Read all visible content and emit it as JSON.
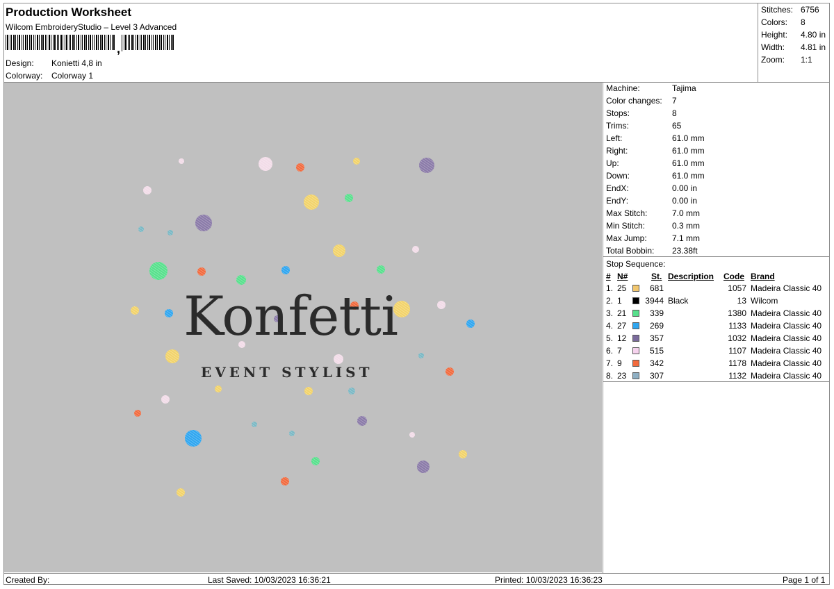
{
  "header": {
    "title": "Production Worksheet",
    "subtitle": "Wilcom EmbroideryStudio – Level 3 Advanced",
    "design_label": "Design:",
    "design_value": "Konietti 4,8 in",
    "colorway_label": "Colorway:",
    "colorway_value": "Colorway 1"
  },
  "summary": [
    {
      "label": "Stitches:",
      "value": "6756"
    },
    {
      "label": "Colors:",
      "value": "8"
    },
    {
      "label": "Height:",
      "value": "4.80 in"
    },
    {
      "label": "Width:",
      "value": "4.81 in"
    },
    {
      "label": "Zoom:",
      "value": "1:1"
    }
  ],
  "machine_info": [
    {
      "label": "Machine:",
      "value": "Tajima"
    },
    {
      "label": "Color changes:",
      "value": "7"
    },
    {
      "label": "Stops:",
      "value": "8"
    },
    {
      "label": "Trims:",
      "value": "65"
    },
    {
      "label": "Left:",
      "value": "61.0 mm"
    },
    {
      "label": "Right:",
      "value": "61.0 mm"
    },
    {
      "label": "Up:",
      "value": "61.0 mm"
    },
    {
      "label": "Down:",
      "value": "61.0 mm"
    },
    {
      "label": "EndX:",
      "value": "0.00 in"
    },
    {
      "label": "EndY:",
      "value": "0.00 in"
    },
    {
      "label": "Max Stitch:",
      "value": "7.0 mm"
    },
    {
      "label": "Min Stitch:",
      "value": "0.3 mm"
    },
    {
      "label": "Max Jump:",
      "value": "7.1 mm"
    },
    {
      "label": "Total Bobbin:",
      "value": "23.38ft"
    }
  ],
  "stop_sequence": {
    "title": "Stop Sequence:",
    "columns": {
      "hash": "#",
      "n": "N#",
      "st": "St.",
      "description": "Description",
      "code": "Code",
      "brand": "Brand"
    },
    "rows": [
      {
        "idx": "1.",
        "n": "25",
        "color": "#f2c76e",
        "st": "681",
        "description": "",
        "code": "1057",
        "brand": "Madeira Classic 40"
      },
      {
        "idx": "2.",
        "n": "1",
        "color": "#000000",
        "st": "3944",
        "description": "Black",
        "code": "13",
        "brand": "Wilcom"
      },
      {
        "idx": "3.",
        "n": "21",
        "color": "#57e08c",
        "st": "339",
        "description": "",
        "code": "1380",
        "brand": "Madeira Classic 40"
      },
      {
        "idx": "4.",
        "n": "27",
        "color": "#2fa6f0",
        "st": "269",
        "description": "",
        "code": "1133",
        "brand": "Madeira Classic 40"
      },
      {
        "idx": "5.",
        "n": "12",
        "color": "#7a6a9c",
        "st": "357",
        "description": "",
        "code": "1032",
        "brand": "Madeira Classic 40"
      },
      {
        "idx": "6.",
        "n": "7",
        "color": "#f6d3ee",
        "st": "515",
        "description": "",
        "code": "1107",
        "brand": "Madeira Classic 40"
      },
      {
        "idx": "7.",
        "n": "9",
        "color": "#f26a3d",
        "st": "342",
        "description": "",
        "code": "1178",
        "brand": "Madeira Classic 40"
      },
      {
        "idx": "8.",
        "n": "23",
        "color": "#8fb0c4",
        "st": "307",
        "description": "",
        "code": "1132",
        "brand": "Madeira Classic 40"
      }
    ]
  },
  "design_preview": {
    "logo_text": "Konfetti",
    "logo_subtext": "EVENT STYLIST",
    "background": "#c0c0c0"
  },
  "footer": {
    "created_by": "Created By:",
    "last_saved": "Last Saved: 10/03/2023 16:36:21",
    "printed": "Printed: 10/03/2023 16:36:23",
    "page": "Page 1 of 1"
  }
}
